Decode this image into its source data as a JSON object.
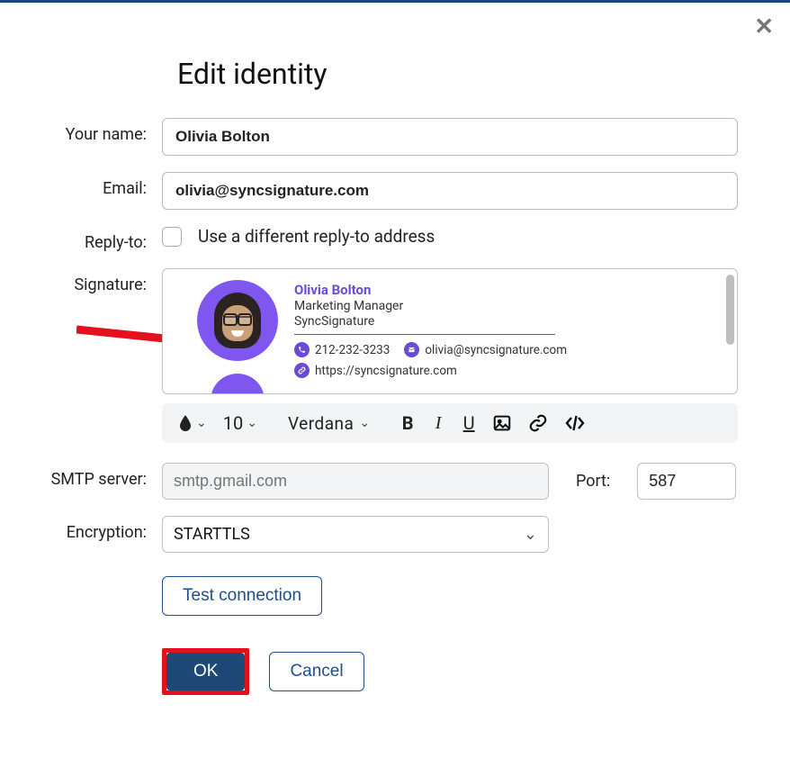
{
  "title": "Edit identity",
  "labels": {
    "your_name": "Your name:",
    "email": "Email:",
    "reply_to": "Reply-to:",
    "signature": "Signature:",
    "smtp": "SMTP server:",
    "port": "Port:",
    "encryption": "Encryption:"
  },
  "fields": {
    "name": "Olivia Bolton",
    "email": "olivia@syncsignature.com",
    "reply_to_checked": false,
    "reply_to_label": "Use a different reply-to address",
    "smtp_placeholder": "smtp.gmail.com",
    "port": "587",
    "encryption_value": "STARTTLS"
  },
  "signature": {
    "name": "Olivia Bolton",
    "role": "Marketing Manager",
    "company": "SyncSignature",
    "phone": "212-232-3233",
    "email": "olivia@syncsignature.com",
    "website": "https://syncsignature.com"
  },
  "toolbar": {
    "size": "10",
    "font": "Verdana",
    "bold": "B",
    "italic": "I",
    "underline": "U"
  },
  "buttons": {
    "test": "Test connection",
    "ok": "OK",
    "cancel": "Cancel"
  },
  "colors": {
    "accent": "#1e4976",
    "signature_purple": "#6b4bd6",
    "annotation_red": "#e5101e"
  }
}
